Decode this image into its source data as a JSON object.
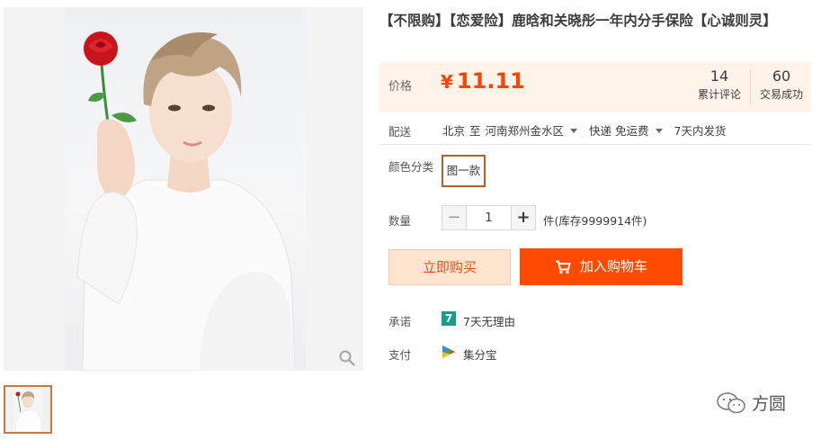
{
  "product": {
    "title": "【不限购】【恋爱险】鹿晗和关晓彤一年内分手保险【心诚则灵】"
  },
  "price": {
    "label": "价格",
    "currency": "¥",
    "value": "11.11",
    "reviews_count": "14",
    "reviews_label": "累计评论",
    "sales_count": "60",
    "sales_label": "交易成功"
  },
  "shipping": {
    "label": "配送",
    "from": "北京",
    "to_word": "至",
    "destination": "河南郑州金水区",
    "method": "快递 免运费",
    "dispatch": "7天内发货"
  },
  "sku": {
    "label": "颜色分类",
    "options": [
      "图一款"
    ]
  },
  "quantity": {
    "label": "数量",
    "minus": "−",
    "value": "1",
    "plus": "+",
    "unit_stock": "件(库存9999914件)"
  },
  "actions": {
    "buy_now": "立即购买",
    "add_to_cart": "加入购物车"
  },
  "promise": {
    "label": "承诺",
    "icon_text": "7",
    "text": "7天无理由"
  },
  "payment": {
    "label": "支付",
    "text": "集分宝"
  },
  "watermark": {
    "text": "方圆"
  },
  "colors": {
    "accent": "#ff4400",
    "cart_button": "#ff4b00",
    "buy_button_bg": "#ffe5d0",
    "price_panel_bg": "#fff3ea",
    "promise_icon": "#14a085",
    "sku_border": "#b5621e"
  },
  "icons": {
    "zoom": "magnifier-icon",
    "cart": "cart-icon",
    "promise": "seven-day-icon",
    "payment": "play-triangle-icon",
    "watermark": "wechat-icon"
  }
}
